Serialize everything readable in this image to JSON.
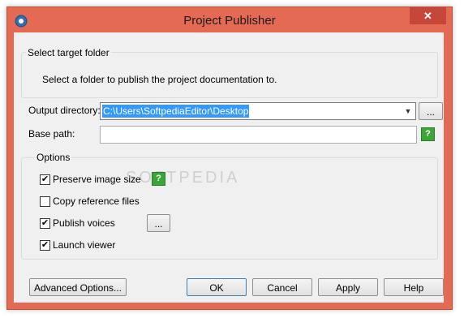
{
  "window": {
    "title": "Project Publisher",
    "close_glyph": "✕",
    "app_icon": "gear-icon",
    "close_icon": "close-icon"
  },
  "target_group": {
    "title": "Select target folder",
    "description": "Select a folder to publish the project documentation to."
  },
  "form": {
    "output_label": "Output directory:",
    "output_value": "C:\\Users\\SoftpediaEditor\\Desktop",
    "browse_label": "...",
    "base_label": "Base path:",
    "base_value": "",
    "help_glyph": "?"
  },
  "options": {
    "title": "Options",
    "preserve_label": "Preserve image size",
    "preserve_checked": true,
    "copy_label": "Copy reference files",
    "copy_checked": false,
    "voices_label": "Publish voices",
    "voices_checked": true,
    "voices_button": "...",
    "viewer_label": "Launch viewer",
    "viewer_checked": true,
    "check_glyph": "✔"
  },
  "buttons": {
    "advanced": "Advanced Options...",
    "ok": "OK",
    "cancel": "Cancel",
    "apply": "Apply",
    "help": "Help"
  },
  "watermark": "SOFTPEDIA",
  "colors": {
    "frame": "#e46a54",
    "selection": "#3399ff",
    "help_green": "#3ca53a"
  }
}
